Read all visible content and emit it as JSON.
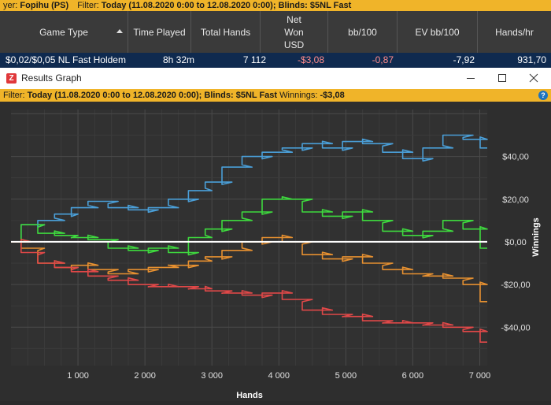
{
  "topbar": {
    "player_prefix": "yer:",
    "player_value": "Fopihu (PS)",
    "filter_label": "Filter:",
    "filter_value": "Today (11.08.2020 0:00 to 12.08.2020 0:00); Blinds: $5NL Fast"
  },
  "grid": {
    "headers": {
      "game_type": "Game Type",
      "time_played": "Time Played",
      "total_hands": "Total Hands",
      "net_won_1": "Net",
      "net_won_2": "Won",
      "net_won_3": "USD",
      "bb100": "bb/100",
      "ev_bb100": "EV bb/100",
      "hands_hr": "Hands/hr"
    },
    "row": {
      "game_type": "$0,02/$0,05 NL Fast Holdem",
      "time_played": "8h 32m",
      "total_hands": "7 112",
      "net_won": "-$3,08",
      "bb100": "-0,87",
      "ev_bb100": "-7,92",
      "hands_hr": "931,70"
    }
  },
  "window": {
    "title": "Results Graph",
    "app_icon_letter": "Z"
  },
  "filterbar": {
    "filter_label": "Filter:",
    "filter_value": "Today (11.08.2020 0:00 to 12.08.2020 0:00); Blinds: $5NL Fast",
    "winnings_label": "Winnings:",
    "winnings_value": "-$3,08",
    "help": "?"
  },
  "chart_data": {
    "type": "line",
    "xlabel": "Hands",
    "ylabel": "Winnings",
    "xlim": [
      0,
      7112
    ],
    "ylim": [
      -58,
      62
    ],
    "x_ticks": [
      {
        "v": 1000,
        "label": "1 000"
      },
      {
        "v": 2000,
        "label": "2 000"
      },
      {
        "v": 3000,
        "label": "3 000"
      },
      {
        "v": 4000,
        "label": "4 000"
      },
      {
        "v": 5000,
        "label": "5 000"
      },
      {
        "v": 6000,
        "label": "6 000"
      },
      {
        "v": 7000,
        "label": "7 000"
      }
    ],
    "y_ticks": [
      {
        "v": 40,
        "label": "$40,00"
      },
      {
        "v": 20,
        "label": "$20,00"
      },
      {
        "v": 0,
        "label": "$0,00"
      },
      {
        "v": -20,
        "label": "-$20,00"
      },
      {
        "v": -40,
        "label": "-$40,00"
      }
    ],
    "grid": true,
    "series": [
      {
        "color": "#4a9fd8",
        "x": [
          0,
          300,
          500,
          800,
          1000,
          1300,
          1600,
          1900,
          2200,
          2500,
          2800,
          3000,
          3300,
          3600,
          3900,
          4200,
          4500,
          4800,
          5100,
          5400,
          5700,
          6000,
          6300,
          6600,
          6900,
          7112
        ],
        "y": [
          0,
          8,
          10,
          13,
          16,
          19,
          16,
          15,
          16,
          20,
          24,
          28,
          35,
          40,
          42,
          44,
          46,
          44,
          47,
          46,
          42,
          39,
          44,
          50,
          48,
          44
        ]
      },
      {
        "color": "#3ed93e",
        "x": [
          0,
          300,
          500,
          800,
          1000,
          1300,
          1600,
          1900,
          2200,
          2500,
          2800,
          3000,
          3300,
          3600,
          3900,
          4200,
          4500,
          4800,
          5100,
          5400,
          5700,
          6000,
          6300,
          6600,
          6900,
          7112
        ],
        "y": [
          0,
          8,
          4,
          3,
          2,
          1,
          -3,
          -4,
          -3,
          -5,
          2,
          6,
          10,
          14,
          20,
          20,
          14,
          12,
          14,
          10,
          5,
          3,
          5,
          10,
          6,
          -3
        ]
      },
      {
        "color": "#e69030",
        "x": [
          0,
          300,
          500,
          800,
          1000,
          1300,
          1600,
          1900,
          2200,
          2500,
          2800,
          3000,
          3300,
          3600,
          3900,
          4200,
          4500,
          4800,
          5100,
          5400,
          5700,
          6000,
          6300,
          6600,
          6900,
          7112
        ],
        "y": [
          0,
          -3,
          -10,
          -12,
          -11,
          -13,
          -15,
          -13,
          -12,
          -11,
          -9,
          -7,
          -4,
          0,
          2,
          0,
          -6,
          -8,
          -7,
          -10,
          -13,
          -15,
          -16,
          -17,
          -20,
          -28
        ]
      },
      {
        "color": "#e04848",
        "x": [
          0,
          300,
          500,
          800,
          1000,
          1300,
          1600,
          1900,
          2200,
          2500,
          2800,
          3000,
          3300,
          3600,
          3900,
          4200,
          4500,
          4800,
          5100,
          5400,
          5700,
          6000,
          6300,
          6600,
          6900,
          7112
        ],
        "y": [
          0,
          -5,
          -10,
          -12,
          -14,
          -16,
          -18,
          -20,
          -21,
          -21,
          -22,
          -23,
          -24,
          -25,
          -24,
          -27,
          -32,
          -34,
          -35,
          -37,
          -38,
          -38,
          -39,
          -40,
          -42,
          -47
        ]
      }
    ]
  },
  "colors": {
    "accent": "#f0b429",
    "selected_row": "#0f2a4f",
    "negative": "#ff8c8c",
    "zero_line": "#ffffff"
  }
}
